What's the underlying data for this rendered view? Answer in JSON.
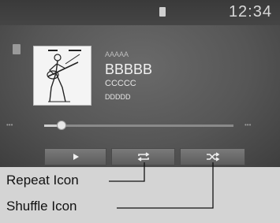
{
  "status": {
    "clock": "12:34"
  },
  "now_playing": {
    "album": "AAAAA",
    "title": "BBBBB",
    "artist": "CCCCC",
    "genre": "DDDDD",
    "progress_fraction": 0.09
  },
  "controls": {
    "play_icon": "play-icon",
    "repeat_icon": "repeat-icon",
    "shuffle_icon": "shuffle-icon"
  },
  "callouts": {
    "repeat_label": "Repeat Icon",
    "shuffle_label": "Shuffle Icon"
  }
}
